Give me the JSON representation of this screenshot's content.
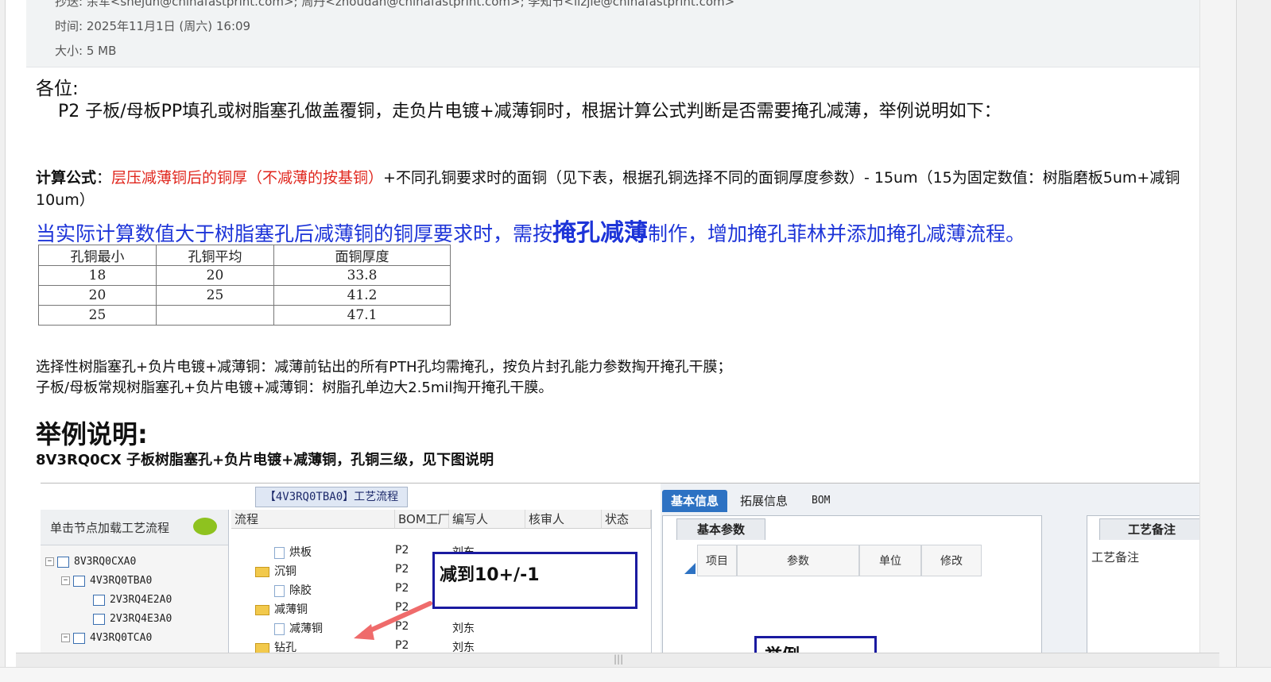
{
  "header": {
    "cc_line": "抄送: 余军<shejun@chinafastprint.com>; 周丹<zhoudan@chinafastprint.com>; 李知节<lizjie@chinafastprint.com>",
    "time_line": "时间: 2025年11月1日 (周六) 16:09",
    "size_line": "大小: 5 MB"
  },
  "body": {
    "greeting": "各位:",
    "intro": "P2  子板/母板PP填孔或树脂塞孔做盖覆铜，走负片电镀+减薄铜时，根据计算公式判断是否需要掩孔减薄，举例说明如下：",
    "formula_label": "计算公式",
    "formula_colon": "：",
    "formula_red": "层压减薄铜后的铜厚（不减薄的按基铜）",
    "formula_rest": "+不同孔铜要求时的面铜（见下表，根据孔铜选择不同的面铜厚度参数）- 15um（15为固定数值：树脂磨板5um+减铜10um）",
    "rule_part1": "当实际计算数值大于树脂塞孔后减薄铜的铜厚要求时，需按",
    "rule_bold": "掩孔减薄",
    "rule_part2": "制作，增加掩孔菲林并添加掩孔减薄流程。",
    "table": {
      "headers": [
        "孔铜最小",
        "孔铜平均",
        "面铜厚度"
      ],
      "rows": [
        [
          "18",
          "20",
          "33.8"
        ],
        [
          "20",
          "25",
          "41.2"
        ],
        [
          "25",
          "",
          "47.1"
        ]
      ]
    },
    "note1": "选择性树脂塞孔+负片电镀+减薄铜：减薄前钻出的所有PTH孔均需掩孔，按负片封孔能力参数掏开掩孔干膜；",
    "note2": "子板/母板常规树脂塞孔+负片电镀+减薄铜：树脂孔单边大2.5mil掏开掩孔干膜。",
    "example_heading": "举例说明:",
    "example_sub": "8V3RQ0CX 子板树脂塞孔+负片电镀+减薄铜，孔铜三级，见下图说明"
  },
  "screenshot": {
    "flow_title": "【4V3RQ0TBA0】工艺流程",
    "left_title": "单击节点加载工艺流程",
    "tree": [
      "8V3RQ0CXA0",
      "4V3RQ0TBA0",
      "2V3RQ4E2A0",
      "2V3RQ4E3A0",
      "4V3RQ0TCA0"
    ],
    "cols": [
      "流程",
      "BOM工厂",
      "编写人",
      "核审人",
      "状态"
    ],
    "rows": [
      {
        "name": "烘板",
        "bom": "P2",
        "writer": "刘东"
      },
      {
        "name": "沉铜",
        "bom": "P2",
        "writer": ""
      },
      {
        "name": "除胶",
        "bom": "P2",
        "writer": ""
      },
      {
        "name": "减薄铜",
        "bom": "P2",
        "writer": ""
      },
      {
        "name": "减薄铜",
        "bom": "P2",
        "writer": "刘东"
      },
      {
        "name": "钻孔",
        "bom": "P2",
        "writer": "刘东"
      }
    ],
    "callout_text": "减到10+/-1",
    "callout2_text": "举例",
    "tabs": [
      "基本信息",
      "拓展信息",
      "BOM"
    ],
    "subtab_basic": "基本参数",
    "subtab_note": "工艺备注",
    "grid_cols": [
      "项目",
      "参数",
      "单位",
      "修改"
    ],
    "note_label": "工艺备注"
  },
  "footer": {
    "grip": "|||"
  }
}
